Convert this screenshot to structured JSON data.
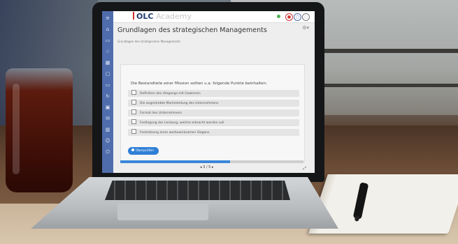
{
  "app": {
    "brand_olc": "OLC",
    "brand_academy": "Academy",
    "accent_color": "#4f6dac",
    "brand_red": "#d32f2f"
  },
  "sidebar": {
    "icons": [
      "menu-icon",
      "home-icon",
      "book-icon",
      "star-icon",
      "grid-icon",
      "chat-icon",
      "folder-icon",
      "refresh-icon",
      "calendar-icon",
      "mail-icon",
      "chart-icon",
      "user-icon",
      "power-icon"
    ]
  },
  "header": {
    "title": "Grundlagen des strategischen Managements",
    "breadcrumb": "Grundlagen des strategischen Managements"
  },
  "quiz": {
    "question": "Die Bestandteile einer Mission sollten u.a. folgende Punkte beinhalten:",
    "options": [
      "Definition des Umgangs mit Gewinnen",
      "Die angestrebte Marktstellung des Unternehmens",
      "Format des Unternehmens",
      "Festlegung der Leistung, welche erbracht werden soll",
      "Festsetzung eines werbewirksamen Slogans"
    ],
    "check_label": "Überprüfen",
    "button_color": "#2f7fd6"
  },
  "pagination": {
    "current": 3,
    "total": 5,
    "text": "◂ 3 / 5 ▸",
    "progress_fraction": 0.6
  }
}
